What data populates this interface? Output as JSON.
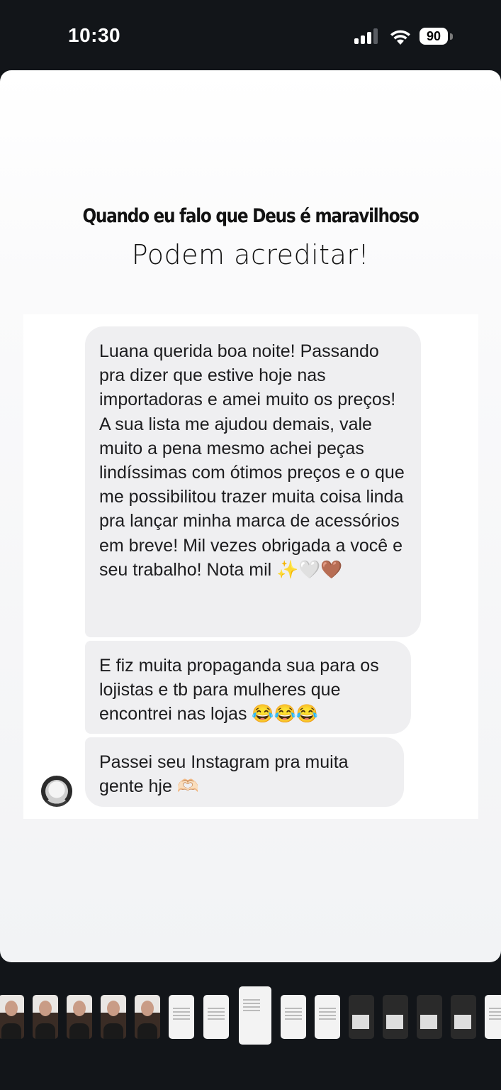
{
  "status_bar": {
    "time": "10:30",
    "battery": "90"
  },
  "story": {
    "headline": "Quando eu falo que Deus é maravilhoso",
    "subline": "Podem acreditar!",
    "messages": [
      "Luana querida boa noite! Passando pra dizer que estive hoje nas importadoras e amei muito os preços! A sua lista me ajudou demais, vale muito a pena mesmo achei peças lindíssimas com ótimos preços e o que me possibilitou trazer muita coisa linda pra lançar minha marca de acessórios em breve! Mil vezes obrigada a você e seu trabalho! Nota mil ✨🤍🤎",
      "E fiz muita propaganda sua para os lojistas e tb para mulheres que encontrei nas lojas 😂😂😂",
      "Passei seu Instagram pra muita gente hje 🫶🏻"
    ]
  },
  "colors": {
    "background": "#121519",
    "bubble": "#efeff1",
    "text": "#1c1c1e"
  }
}
